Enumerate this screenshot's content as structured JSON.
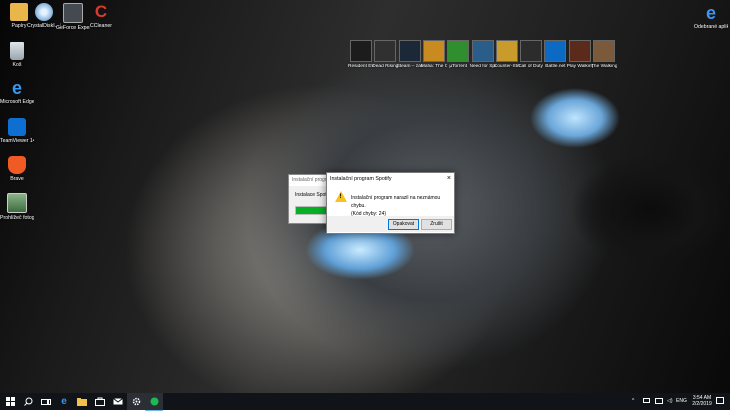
{
  "desktop_icons_left": [
    {
      "label": "Papíry",
      "icon": "folder-icon",
      "color": "#e8b64a"
    },
    {
      "label": "CrystalDiskI... Kurze Kei Ed...",
      "icon": "crystaldisk-icon",
      "color": "#7fb0d8"
    },
    {
      "label": "GeForce Experience",
      "icon": "geforce-icon",
      "color": "#444a4f"
    },
    {
      "label": "CCleaner",
      "icon": "ccleaner-icon",
      "color": "#d83b2a"
    },
    {
      "label": "Koš",
      "icon": "recycle-bin-icon",
      "color": "#cfd6dd"
    },
    {
      "label": "Microsoft Edge",
      "icon": "edge-icon",
      "color": "#1e7ad6"
    },
    {
      "label": "TeamViewer 14",
      "icon": "teamviewer-icon",
      "color": "#0e6fd1"
    },
    {
      "label": "Brave",
      "icon": "brave-icon",
      "color": "#f05a24"
    },
    {
      "label": "Prohlížeč fotografií ...",
      "icon": "photo-viewer-icon",
      "color": "#4a7a4a"
    }
  ],
  "desktop_icon_right": {
    "label": "Odebrané aplikace",
    "icon": "edge-icon",
    "color": "#1e7ad6"
  },
  "game_icons": [
    {
      "label": "Resident Evil 2",
      "color": "#1c1c1c"
    },
    {
      "label": "Dead Rising 2",
      "color": "#303030"
    },
    {
      "label": "Steam – zástupce",
      "color": "#1b2838"
    },
    {
      "label": "Mafia: The Old Country",
      "color": "#c98a1f"
    },
    {
      "label": "µTorrent",
      "color": "#2f8f2f"
    },
    {
      "label": "Need for Speed...",
      "color": "#2a5d8a"
    },
    {
      "label": "Counter-Strike Global Offe...",
      "color": "#c89b2a"
    },
    {
      "label": "Call of Duty Modern ...",
      "color": "#2c2c2c"
    },
    {
      "label": "Battle.net",
      "color": "#0c6ac3"
    },
    {
      "label": "Play Walking Dead 3",
      "color": "#5a2a1a"
    },
    {
      "label": "The Walking Dead",
      "color": "#7a5a3a"
    }
  ],
  "background_window": {
    "title": "Instalační progra...",
    "text": "Instalace Spotify",
    "progress": 0.55
  },
  "dialog": {
    "title": "Instalační program Spotify",
    "close": "×",
    "message_line1": "Instalační program narazil na neznámou chybu.",
    "message_line2": "(Kód chyby: 24)",
    "ok_label": "Opakovat",
    "cancel_label": "Zrušit"
  },
  "taskbar": {
    "time": "3:54 AM",
    "date": "2/2/2019",
    "language": "ENG"
  },
  "colors": {
    "taskbar_bg": "#101418",
    "progress_fill": "#06b025",
    "accent": "#0078d7"
  }
}
